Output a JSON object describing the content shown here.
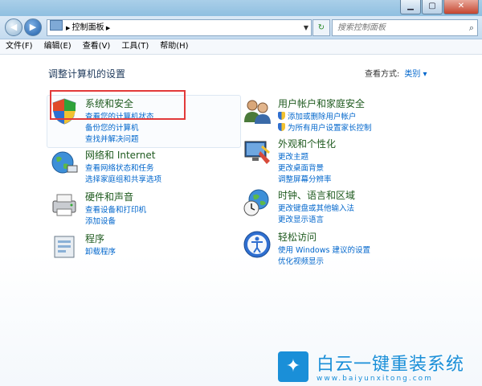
{
  "window": {
    "minimize_glyph": "▁",
    "maximize_glyph": "▢",
    "close_glyph": "✕"
  },
  "address": {
    "path": "控制面板",
    "search_placeholder": "搜索控制面板"
  },
  "menu": [
    "文件(F)",
    "编辑(E)",
    "查看(V)",
    "工具(T)",
    "帮助(H)"
  ],
  "page": {
    "title": "调整计算机的设置",
    "view_by_label": "查看方式:",
    "view_by_value": "类别"
  },
  "categories": [
    {
      "title": "系统和安全",
      "icon": "system-security-icon",
      "links": [
        "查看您的计算机状态",
        "备份您的计算机",
        "查找并解决问题"
      ]
    },
    {
      "title": "网络和 Internet",
      "icon": "network-internet-icon",
      "links": [
        "查看网络状态和任务",
        "选择家庭组和共享选项"
      ]
    },
    {
      "title": "硬件和声音",
      "icon": "hardware-sound-icon",
      "links": [
        "查看设备和打印机",
        "添加设备"
      ]
    },
    {
      "title": "程序",
      "icon": "programs-icon",
      "links": [
        "卸载程序"
      ]
    },
    {
      "title": "用户帐户和家庭安全",
      "icon": "user-accounts-icon",
      "links": [
        "添加或删除用户帐户",
        "为所有用户设置家长控制"
      ]
    },
    {
      "title": "外观和个性化",
      "icon": "appearance-icon",
      "links": [
        "更改主题",
        "更改桌面背景",
        "调整屏幕分辨率"
      ]
    },
    {
      "title": "时钟、语言和区域",
      "icon": "clock-language-region-icon",
      "links": [
        "更改键盘或其他输入法",
        "更改显示语言"
      ]
    },
    {
      "title": "轻松访问",
      "icon": "ease-of-access-icon",
      "links": [
        "使用 Windows 建议的设置",
        "优化视频显示"
      ]
    }
  ],
  "watermark": {
    "name": "白云一键重装系统",
    "url": "www.baiyunxitong.com"
  },
  "colors": {
    "highlight_box": "#e23a3a",
    "link": "#0066cc",
    "category_title": "#1e5a1e",
    "brand": "#1a8fd8"
  }
}
